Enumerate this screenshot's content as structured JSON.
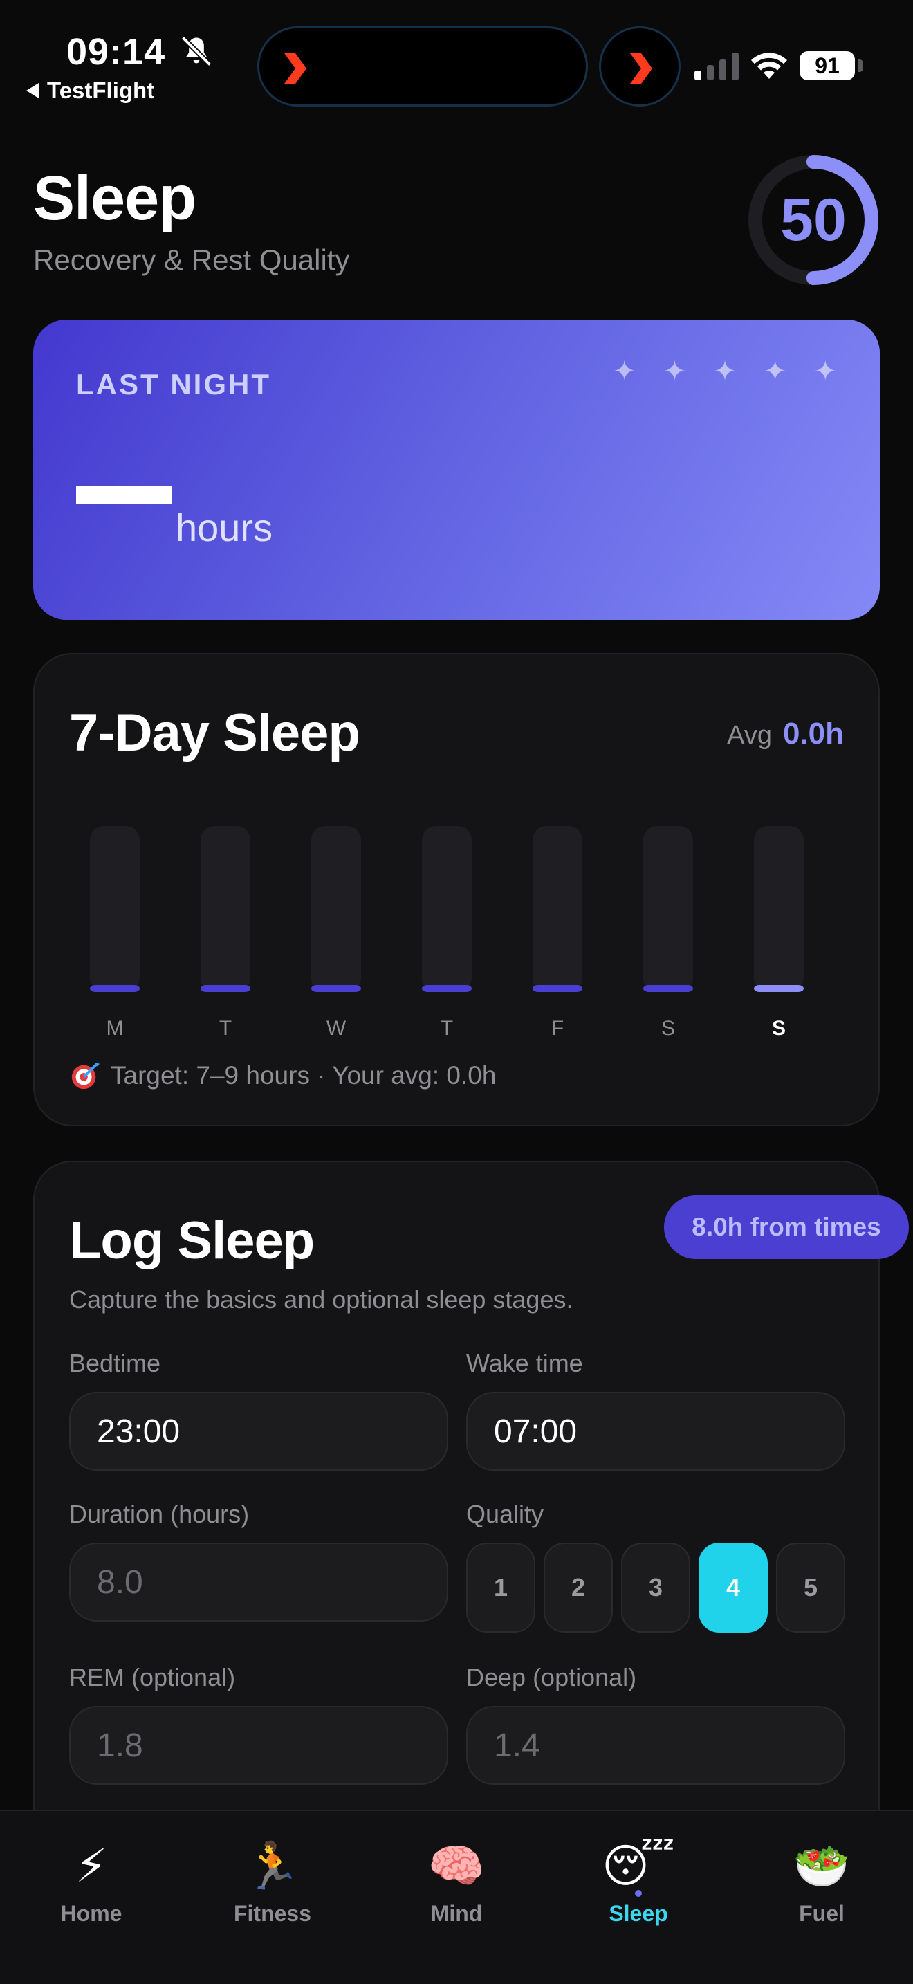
{
  "status_bar": {
    "time": "09:14",
    "back_app": "TestFlight",
    "battery": "91",
    "icons": [
      "bell-slash-icon",
      "signal-icon",
      "wifi-icon",
      "battery-icon"
    ]
  },
  "header": {
    "title": "Sleep",
    "subtitle": "Recovery & Rest Quality",
    "score": "50",
    "score_fraction": 0.5,
    "accent_color": "#8b8ff7"
  },
  "last_night": {
    "label": "LAST NIGHT",
    "unit": "hours",
    "stars": "✦ ✦ ✦ ✦ ✦",
    "gradient": [
      "#4438cf",
      "#8489f6"
    ]
  },
  "week": {
    "title": "7-Day Sleep",
    "avg_label": "Avg",
    "avg_value": "0.0h",
    "target_text": "Target: 7–9 hours · Your avg: 0.0h",
    "chart_data": {
      "type": "bar",
      "categories": [
        "M",
        "T",
        "W",
        "T",
        "F",
        "S",
        "S"
      ],
      "values": [
        0,
        0,
        0,
        0,
        0,
        0,
        0
      ],
      "highlight_index": 6,
      "bar_color": "#4b3fd3",
      "highlight_color": "#8b8ff7",
      "track_color": "#1f1f23"
    }
  },
  "log": {
    "title": "Log Sleep",
    "badge": "8.0h from times",
    "description": "Capture the basics and optional sleep stages.",
    "bedtime_label": "Bedtime",
    "bedtime_value": "23:00",
    "wake_label": "Wake time",
    "wake_value": "07:00",
    "duration_label": "Duration (hours)",
    "duration_placeholder": "8.0",
    "quality_label": "Quality",
    "quality_options": [
      "1",
      "2",
      "3",
      "4",
      "5"
    ],
    "quality_selected": 4,
    "quality_color": "#20d2ea",
    "rem_label": "REM (optional)",
    "rem_placeholder": "1.8",
    "deep_label": "Deep (optional)",
    "deep_placeholder": "1.4"
  },
  "tabs": [
    {
      "label": "Home",
      "emoji": "⚡",
      "icon": "lightning-icon"
    },
    {
      "label": "Fitness",
      "emoji": "🏃",
      "icon": "runner-icon"
    },
    {
      "label": "Mind",
      "emoji": "🧠",
      "icon": "brain-icon"
    },
    {
      "label": "Sleep",
      "emoji": "😴",
      "icon": "sleeping-face-icon",
      "active": true
    },
    {
      "label": "Fuel",
      "emoji": "🥗",
      "icon": "salad-icon"
    }
  ]
}
